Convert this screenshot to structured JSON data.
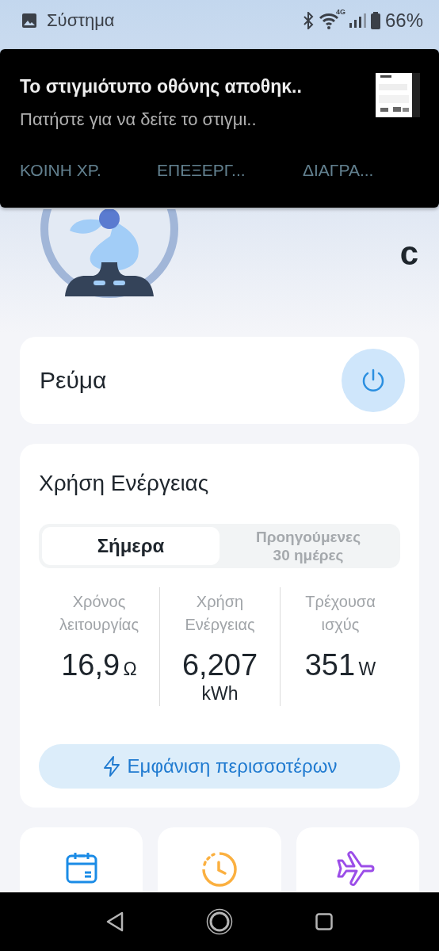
{
  "status_bar": {
    "app_label": "Σύστημα",
    "network": "4G",
    "battery": "66%"
  },
  "notification": {
    "title": "Το στιγμιότυπο οθόνης αποθηκ..",
    "text": "Πατήστε για να δείτε το στιγμι..",
    "actions": [
      "ΚΟΙΝΗ ΧΡ.",
      "ΕΠΕΞΕΡΓ...",
      "ΔΙΑΓΡΑ..."
    ]
  },
  "device": {
    "name": "c"
  },
  "power": {
    "label": "Ρεύμα"
  },
  "energy": {
    "title": "Χρήση Ενέργειας",
    "tabs": [
      {
        "label": "Σήμερα",
        "selected": true
      },
      {
        "label": "Προηγούμενες 30 ημέρες",
        "selected": false
      }
    ],
    "stats": [
      {
        "label": "Χρόνος λειτουργίας",
        "value": "16,9",
        "unit": "Ω"
      },
      {
        "label": "Χρήση Ενέργειας",
        "value": "6,207",
        "unit": "kWh"
      },
      {
        "label": "Τρέχουσα ισχύς",
        "value": "351",
        "unit": "W"
      }
    ],
    "more_button": "Εμφάνιση περισσοτέρων"
  },
  "shortcuts": [
    {
      "kind": "calendar"
    },
    {
      "kind": "timer"
    },
    {
      "kind": "flight"
    }
  ]
}
